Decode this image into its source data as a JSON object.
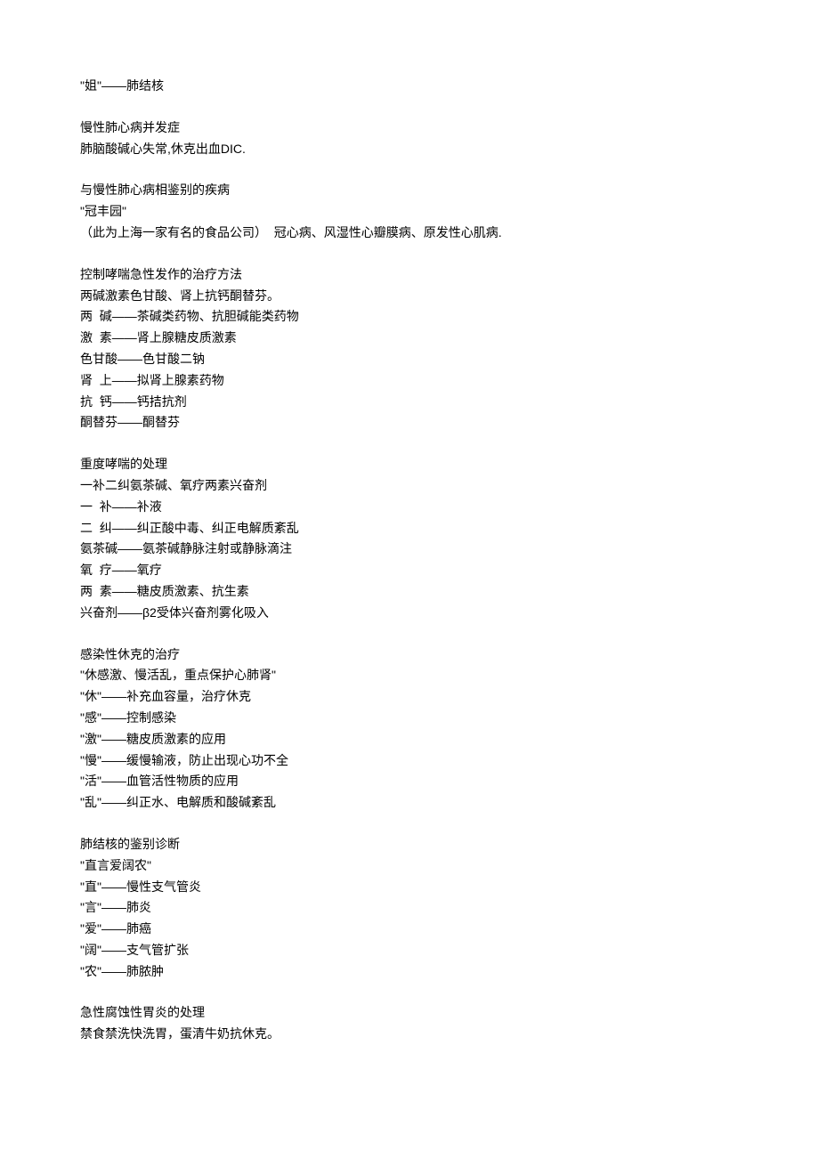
{
  "sections": [
    [
      "\"姐\"——肺结核"
    ],
    [
      "慢性肺心病并发症",
      "肺脑酸碱心失常,休克出血DIC."
    ],
    [
      "与慢性肺心病相鉴别的疾病",
      "\"冠丰园\"",
      "（此为上海一家有名的食品公司）  冠心病、风湿性心瓣膜病、原发性心肌病."
    ],
    [
      "控制哮喘急性发作的治疗方法",
      "两碱激素色甘酸、肾上抗钙酮替芬。",
      "两  碱——茶碱类药物、抗胆碱能类药物",
      "激  素——肾上腺糖皮质激素",
      "色甘酸——色甘酸二钠",
      "肾  上——拟肾上腺素药物",
      "抗  钙——钙拮抗剂",
      "酮替芬——酮替芬"
    ],
    [
      "重度哮喘的处理",
      "一补二纠氨茶碱、氧疗两素兴奋剂",
      "一  补——补液",
      "二  纠——纠正酸中毒、纠正电解质紊乱",
      "氨茶碱——氨茶碱静脉注射或静脉滴注",
      "氧  疗——氧疗",
      "两  素——糖皮质激素、抗生素",
      "兴奋剂——β2受体兴奋剂雾化吸入"
    ],
    [
      "感染性休克的治疗",
      "\"休感激、慢活乱，重点保护心肺肾\"",
      "\"休\"——补充血容量，治疗休克",
      "\"感\"——控制感染",
      "\"激\"——糖皮质激素的应用",
      "\"慢\"——缓慢输液，防止出现心功不全",
      "\"活\"——血管活性物质的应用",
      "\"乱\"——纠正水、电解质和酸碱紊乱"
    ],
    [
      "肺结核的鉴别诊断",
      "\"直言爱阔农\"",
      "\"直\"——慢性支气管炎",
      "\"言\"——肺炎",
      "\"爱\"——肺癌",
      "\"阔\"——支气管扩张",
      "\"农\"——肺脓肿"
    ],
    [
      "急性腐蚀性胃炎的处理",
      "禁食禁洗快洗胃，蛋清牛奶抗休克。"
    ]
  ]
}
